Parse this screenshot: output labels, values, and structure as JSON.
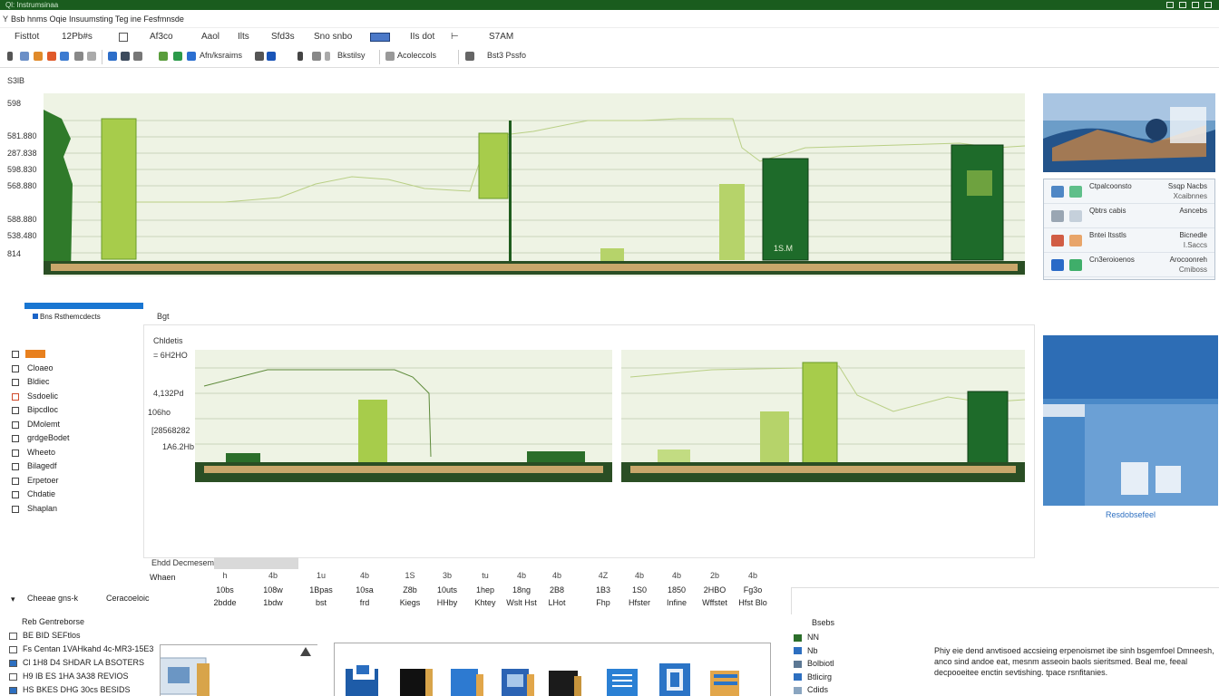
{
  "window": {
    "title": "Ql: Instrumsinaa",
    "doc_title": "Bsb hnms Oqie Insuumsting Teg ine Fesfmnsde"
  },
  "menu": {
    "lead": "Y"
  },
  "ribbon": {
    "tabs": [
      "Fisttot",
      "12Pb#s",
      "Af3co",
      "Aaol",
      "Ilts",
      "Sfd3s",
      "Sno snbo",
      "IIs dot",
      "S7AM"
    ]
  },
  "toolbar": {
    "group1_label": "Afn/ksraims",
    "group2_label": "Bkstilsy",
    "group3_label": "Acoleccols",
    "group4_label": "Bst3 Pssfo"
  },
  "left_axis": {
    "top_label": "S3lB",
    "ticks": [
      "598",
      "581.880",
      "287.838",
      "598.830",
      "568.880",
      "588.880",
      "538.480",
      "814"
    ]
  },
  "panel": {
    "header": "Bns Rsthemcdects",
    "mid_tab": "Bgt",
    "nav_items": [
      "",
      "Cloaeo",
      "Bldiec",
      "Ssdoelic",
      "Bipcdloc",
      "DMolemt",
      "grdgeBodet",
      "Wheeto",
      "Bilagedf",
      "Erpetoer",
      "Chdatie",
      "Shaplan"
    ]
  },
  "mid_chart": {
    "ylabels": [
      "Chldetis",
      "= 6H2HO",
      "4,132Pd",
      "106ho",
      "[28568282",
      "1A6.2Hb"
    ]
  },
  "top_chart_data": {
    "labels": [
      "1S.M"
    ]
  },
  "right_list": {
    "rows": [
      {
        "t1": "Ctpalcoonsto",
        "t2": "Ssqp Nacbs",
        "t3": "Xcaibnnes"
      },
      {
        "t1": "Qbtrs cabis",
        "t2": "Asncebs",
        "t3": ""
      },
      {
        "t1": "Bntei Itsstls",
        "t2": "Bicnedle",
        "t3": "I.Saccs"
      },
      {
        "t1": "Cn3eroioenos",
        "t2": "Arocoonreh",
        "t3": "Cmiboss"
      }
    ]
  },
  "blue_panel": {
    "caption": "Resdobsefeel"
  },
  "status": {
    "left_label": "Ehdd Decmesem"
  },
  "grid": {
    "row_label": "Whaen",
    "columns": [
      {
        "l1": "h",
        "l2": "10bs",
        "l3": "2bdde"
      },
      {
        "l1": "4b",
        "l2": "108w",
        "l3": "1bdw"
      },
      {
        "l1": "1u",
        "l2": "1Bpas",
        "l3": "bst"
      },
      {
        "l1": "4b",
        "l2": "10sa",
        "l3": "frd"
      },
      {
        "l1": "1S",
        "l2": "Z8b",
        "l3": "Kiegs"
      },
      {
        "l1": "3b",
        "l2": "10uts",
        "l3": "HHby"
      },
      {
        "l1": "tu",
        "l2": "1hep",
        "l3": "Khtey"
      },
      {
        "l1": "4b",
        "l2": "18ng",
        "l3": "Wslt Hst"
      },
      {
        "l1": "4b",
        "l2": "2B8",
        "l3": "LHot"
      },
      {
        "l1": "4Z",
        "l2": "1B3",
        "l3": "Fhp"
      },
      {
        "l1": "4b",
        "l2": "1S0",
        "l3": "Hfster"
      },
      {
        "l1": "4b",
        "l2": "1850",
        "l3": "Infine"
      },
      {
        "l1": "2b",
        "l2": "2HBO",
        "l3": "Wffstet"
      },
      {
        "l1": "4b",
        "l2": "Fg3o",
        "l3": "Hfst Blo"
      }
    ]
  },
  "bottom_left": {
    "line1": "Cheeae gns-k",
    "line2": "Ceracoeloic",
    "tree": [
      "Reb Gentreborse",
      "BE BID SEFtlos",
      "Fs Centan 1VAHkahd 4c-MR3-15E3",
      "Cl 1H8 D4 SHDAR LA BSOTERS",
      "H9 IB ES 1HA 3A38 REVIOS",
      "HS BKES DHG 30cs BESIDS"
    ]
  },
  "props": {
    "header": "Bsebs",
    "items": [
      "NN",
      "Nb",
      "Bolbiotl",
      "Btlicirg",
      "Cdids"
    ]
  },
  "description": "Phiy eie dend anvtisoed accsieing erpenoismet ibe sinh bsgemfoel Dmneesh, anco sind andoe eat, mesnm asseoin baols sieritsmed. Beal me, feeal decpooeitee enctin sevtishing. tpace rsnfitanies."
}
